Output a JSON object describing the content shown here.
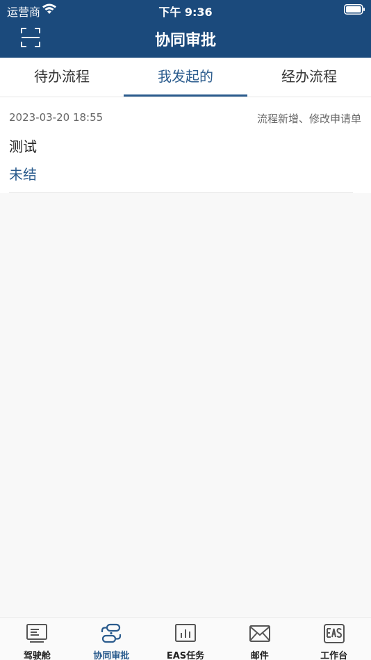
{
  "status_bar": {
    "carrier": "运营商",
    "time": "下午 9:36"
  },
  "header": {
    "title": "协同审批",
    "scan_icon": "scan-icon"
  },
  "tabs": [
    {
      "label": "待办流程",
      "active": false
    },
    {
      "label": "我发起的",
      "active": true
    },
    {
      "label": "经办流程",
      "active": false
    }
  ],
  "items": [
    {
      "date": "2023-03-20 18:55",
      "type": "流程新增、修改申请单",
      "title": "测试",
      "status": "未结"
    }
  ],
  "tabbar": [
    {
      "label": "驾驶舱",
      "icon": "dashboard-icon",
      "active": false
    },
    {
      "label": "协同审批",
      "icon": "workflow-icon",
      "active": true
    },
    {
      "label": "EAS任务",
      "icon": "chart-icon",
      "active": false
    },
    {
      "label": "邮件",
      "icon": "mail-icon",
      "active": false
    },
    {
      "label": "工作台",
      "icon": "eas-icon",
      "active": false
    }
  ],
  "colors": {
    "header": "#1b4a7c",
    "accent": "#2a5b8d"
  }
}
